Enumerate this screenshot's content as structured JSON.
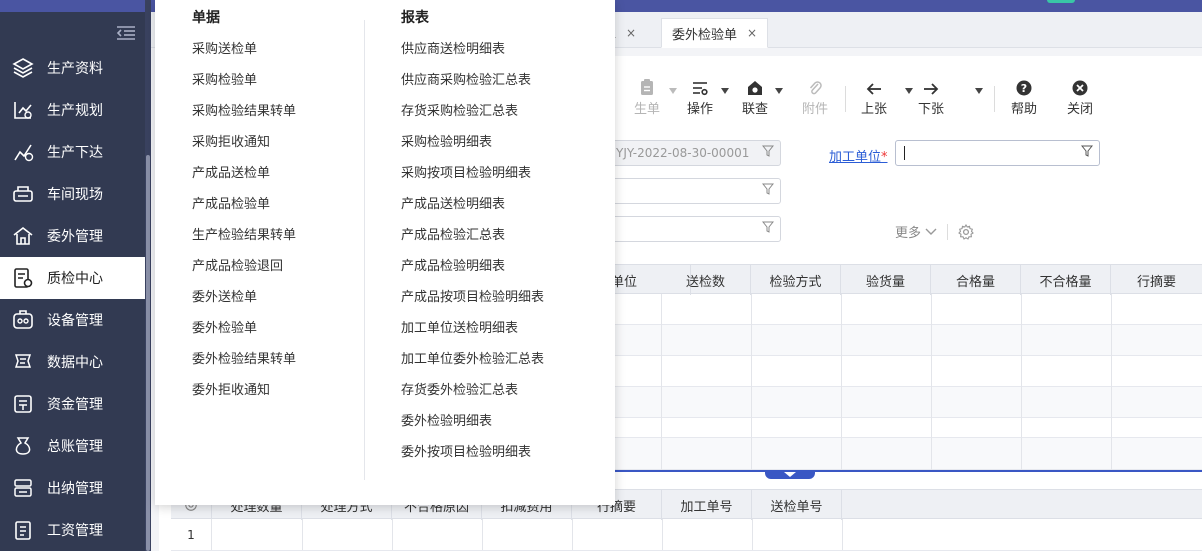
{
  "sidebar": {
    "items": [
      {
        "label": "生产资料",
        "icon": "layers-icon"
      },
      {
        "label": "生产规划",
        "icon": "planning-icon"
      },
      {
        "label": "生产下达",
        "icon": "dispatch-icon"
      },
      {
        "label": "车间现场",
        "icon": "workshop-icon"
      },
      {
        "label": "委外管理",
        "icon": "outsource-icon"
      },
      {
        "label": "质检中心",
        "icon": "inspection-icon",
        "active": true
      },
      {
        "label": "设备管理",
        "icon": "equipment-icon"
      },
      {
        "label": "数据中心",
        "icon": "data-icon"
      },
      {
        "label": "资金管理",
        "icon": "fund-icon"
      },
      {
        "label": "总账管理",
        "icon": "ledger-icon"
      },
      {
        "label": "出纳管理",
        "icon": "cashier-icon"
      },
      {
        "label": "工资管理",
        "icon": "salary-icon"
      }
    ]
  },
  "tabs": [
    {
      "label": "单",
      "closable": true
    },
    {
      "label": "委外检验单",
      "closable": true,
      "active": true
    }
  ],
  "tab_close": "×",
  "toolbar": {
    "generate": "生单",
    "operate": "操作",
    "link_query": "联查",
    "attachment": "附件",
    "prev": "上张",
    "next": "下张",
    "help": "帮助",
    "close": "关闭"
  },
  "form": {
    "doc_no_value": "YJY-2022-08-30-00001",
    "processing_unit_label": "加工单位",
    "required_mark": "*",
    "processing_unit_value": "",
    "more_label": "更多"
  },
  "table": {
    "columns": [
      "单位",
      "送检数",
      "检验方式",
      "验货量",
      "合格量",
      "不合格量",
      "行摘要"
    ]
  },
  "sub_table": {
    "columns": [
      "处理数量",
      "处理方式",
      "不合格原因",
      "扣减费用",
      "行摘要",
      "加工单号",
      "送检单号"
    ],
    "row_no": "1"
  },
  "menu": {
    "docs_header": "单据",
    "docs": [
      "采购送检单",
      "采购检验单",
      "采购检验结果转单",
      "采购拒收通知",
      "产成品送检单",
      "产成品检验单",
      "生产检验结果转单",
      "产成品检验退回",
      "委外送检单",
      "委外检验单",
      "委外检验结果转单",
      "委外拒收通知"
    ],
    "reports_header": "报表",
    "reports": [
      "供应商送检明细表",
      "供应商采购检验汇总表",
      "存货采购检验汇总表",
      "采购检验明细表",
      "采购按项目检验明细表",
      "产成品送检明细表",
      "产成品检验汇总表",
      "产成品检验明细表",
      "产成品按项目检验明细表",
      "加工单位送检明细表",
      "加工单位委外检验汇总表",
      "存货委外检验汇总表",
      "委外检验明细表",
      "委外按项目检验明细表"
    ]
  },
  "colors": {
    "sidebar_bg": "#323a52",
    "header_bg": "#4a55a2",
    "accent": "#3a57c4",
    "link": "#2b5dd6",
    "required": "#e33333"
  }
}
